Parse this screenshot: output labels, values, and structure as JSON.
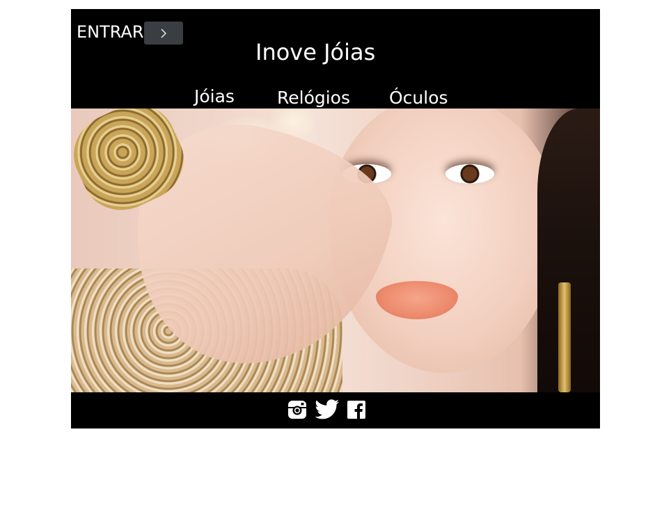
{
  "header": {
    "login_label": "ENTRAR",
    "login_button_icon": "chevron-right-icon",
    "site_title": "Inove Jóias"
  },
  "nav": {
    "items": [
      {
        "label": "Jóias"
      },
      {
        "label": "Relógios"
      },
      {
        "label": "Óculos"
      }
    ]
  },
  "hero": {
    "image_alt": "Banner"
  },
  "footer": {
    "social_icons": [
      "instagram-icon",
      "twitter-icon",
      "facebook-icon"
    ]
  },
  "colors": {
    "background": "#000000",
    "page_background": "#ffffff",
    "text": "#ffffff",
    "button": "#3a3d42"
  }
}
